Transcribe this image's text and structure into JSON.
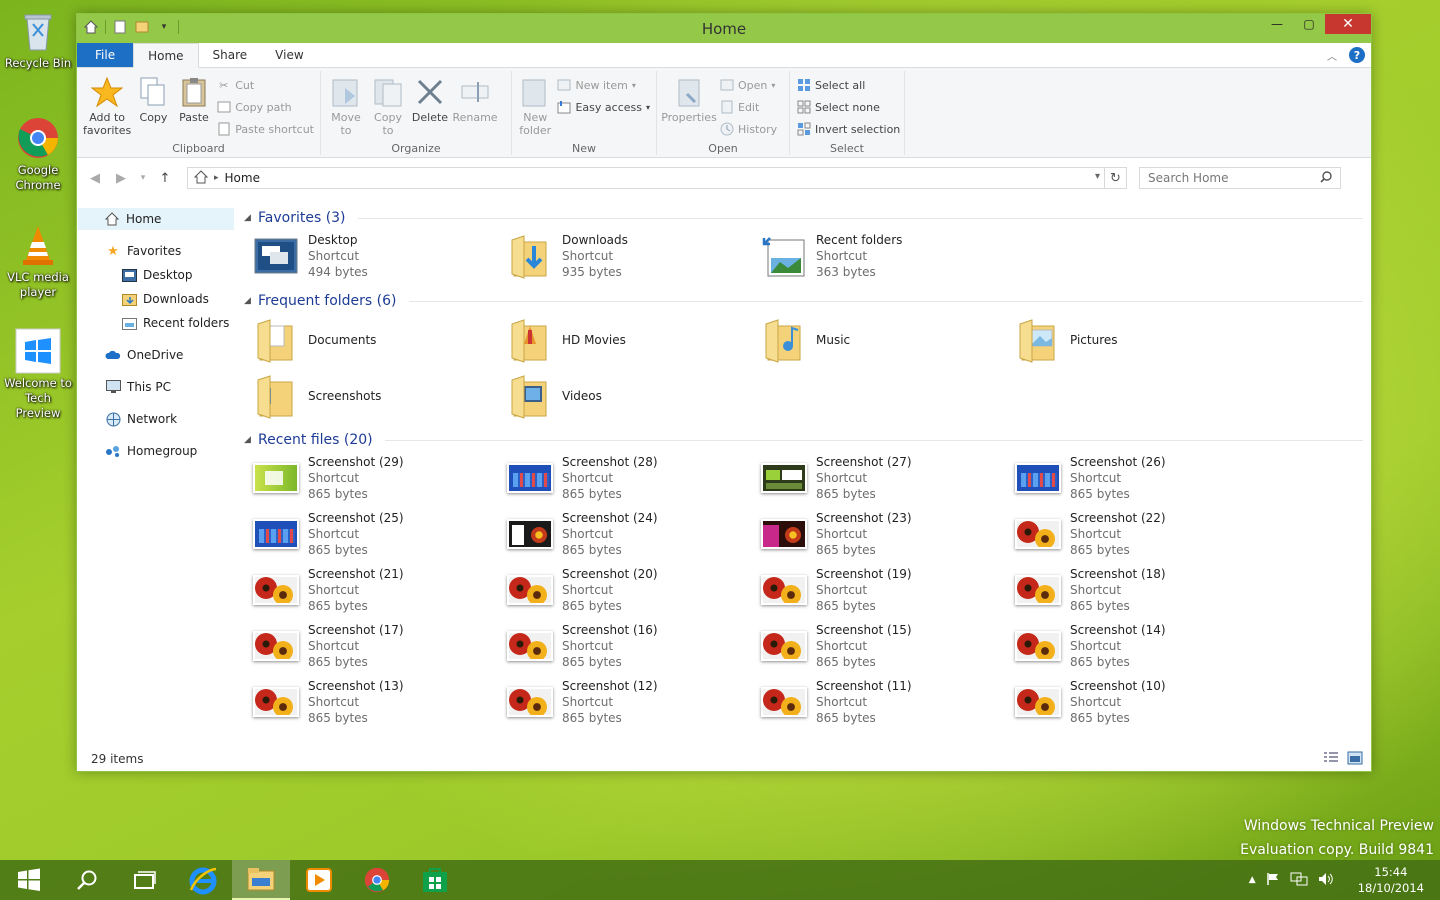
{
  "desktop": {
    "icons": [
      {
        "label": "Recycle Bin"
      },
      {
        "label": "Google Chrome"
      },
      {
        "label": "VLC media player"
      },
      {
        "label": "Welcome to Tech Preview"
      }
    ],
    "watermark": {
      "line1": "Windows Technical Preview",
      "line2": "Evaluation copy. Build 9841"
    }
  },
  "window": {
    "title": "Home",
    "tabs": {
      "file": "File",
      "home": "Home",
      "share": "Share",
      "view": "View"
    },
    "ribbon": {
      "clipboard": {
        "label": "Clipboard",
        "add_to_favorites": "Add to favorites",
        "copy": "Copy",
        "paste": "Paste",
        "cut": "Cut",
        "copy_path": "Copy path",
        "paste_shortcut": "Paste shortcut"
      },
      "organize": {
        "label": "Organize",
        "move_to": "Move to",
        "copy_to": "Copy to",
        "delete": "Delete",
        "rename": "Rename"
      },
      "new": {
        "label": "New",
        "new_folder": "New folder",
        "new_item": "New item",
        "easy_access": "Easy access"
      },
      "open": {
        "label": "Open",
        "properties": "Properties",
        "open": "Open",
        "edit": "Edit",
        "history": "History"
      },
      "select": {
        "label": "Select",
        "select_all": "Select all",
        "select_none": "Select none",
        "invert_selection": "Invert selection"
      }
    },
    "address": {
      "crumb": "Home",
      "search_placeholder": "Search Home"
    },
    "nav": {
      "home": "Home",
      "favorites": "Favorites",
      "desktop": "Desktop",
      "downloads": "Downloads",
      "recent_folders": "Recent folders",
      "onedrive": "OneDrive",
      "this_pc": "This PC",
      "network": "Network",
      "homegroup": "Homegroup"
    },
    "sections": {
      "favorites": {
        "title": "Favorites (3)",
        "items": [
          {
            "name": "Desktop",
            "type": "Shortcut",
            "size": "494 bytes",
            "icon": "desktop-icon"
          },
          {
            "name": "Downloads",
            "type": "Shortcut",
            "size": "935 bytes",
            "icon": "downloads-folder-icon"
          },
          {
            "name": "Recent folders",
            "type": "Shortcut",
            "size": "363 bytes",
            "icon": "recent-folders-icon"
          }
        ]
      },
      "frequent": {
        "title": "Frequent folders (6)",
        "items": [
          {
            "name": "Documents",
            "icon": "documents-folder-icon"
          },
          {
            "name": "HD Movies",
            "icon": "hd-movies-folder-icon"
          },
          {
            "name": "Music",
            "icon": "music-folder-icon"
          },
          {
            "name": "Pictures",
            "icon": "pictures-folder-icon"
          },
          {
            "name": "Screenshots",
            "icon": "screenshots-folder-icon"
          },
          {
            "name": "Videos",
            "icon": "videos-folder-icon"
          }
        ]
      },
      "recent": {
        "title": "Recent files (20)",
        "items": [
          {
            "name": "Screenshot (29)",
            "type": "Shortcut",
            "size": "865 bytes",
            "thumb": "lime"
          },
          {
            "name": "Screenshot (28)",
            "type": "Shortcut",
            "size": "865 bytes",
            "thumb": "blue-tiles"
          },
          {
            "name": "Screenshot (27)",
            "type": "Shortcut",
            "size": "865 bytes",
            "thumb": "dark-green"
          },
          {
            "name": "Screenshot (26)",
            "type": "Shortcut",
            "size": "865 bytes",
            "thumb": "blue-tiles"
          },
          {
            "name": "Screenshot (25)",
            "type": "Shortcut",
            "size": "865 bytes",
            "thumb": "blue-tiles"
          },
          {
            "name": "Screenshot (24)",
            "type": "Shortcut",
            "size": "865 bytes",
            "thumb": "flower-dark"
          },
          {
            "name": "Screenshot (23)",
            "type": "Shortcut",
            "size": "865 bytes",
            "thumb": "flower-pink"
          },
          {
            "name": "Screenshot (22)",
            "type": "Shortcut",
            "size": "865 bytes",
            "thumb": "flower"
          },
          {
            "name": "Screenshot (21)",
            "type": "Shortcut",
            "size": "865 bytes",
            "thumb": "flower"
          },
          {
            "name": "Screenshot (20)",
            "type": "Shortcut",
            "size": "865 bytes",
            "thumb": "flower"
          },
          {
            "name": "Screenshot (19)",
            "type": "Shortcut",
            "size": "865 bytes",
            "thumb": "flower"
          },
          {
            "name": "Screenshot (18)",
            "type": "Shortcut",
            "size": "865 bytes",
            "thumb": "flower"
          },
          {
            "name": "Screenshot (17)",
            "type": "Shortcut",
            "size": "865 bytes",
            "thumb": "flower"
          },
          {
            "name": "Screenshot (16)",
            "type": "Shortcut",
            "size": "865 bytes",
            "thumb": "flower"
          },
          {
            "name": "Screenshot (15)",
            "type": "Shortcut",
            "size": "865 bytes",
            "thumb": "flower"
          },
          {
            "name": "Screenshot (14)",
            "type": "Shortcut",
            "size": "865 bytes",
            "thumb": "flower"
          },
          {
            "name": "Screenshot (13)",
            "type": "Shortcut",
            "size": "865 bytes",
            "thumb": "flower"
          },
          {
            "name": "Screenshot (12)",
            "type": "Shortcut",
            "size": "865 bytes",
            "thumb": "flower"
          },
          {
            "name": "Screenshot (11)",
            "type": "Shortcut",
            "size": "865 bytes",
            "thumb": "flower"
          },
          {
            "name": "Screenshot (10)",
            "type": "Shortcut",
            "size": "865 bytes",
            "thumb": "flower"
          }
        ]
      }
    },
    "status": {
      "count": "29 items"
    }
  },
  "taskbar": {
    "time": "15:44",
    "date": "18/10/2014"
  },
  "colors": {
    "titlebar": "#93c849",
    "file_tab": "#1c6fc4",
    "section_title": "#1e3c96",
    "close_button": "#c7372f"
  }
}
